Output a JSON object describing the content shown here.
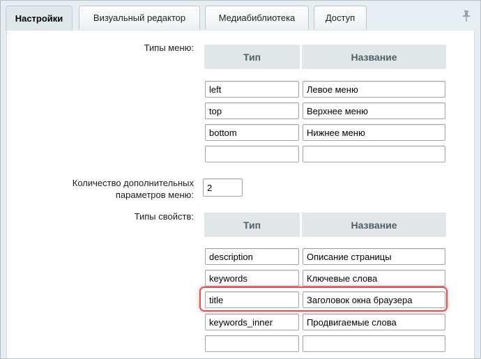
{
  "tabs": [
    {
      "label": "Настройки",
      "active": true
    },
    {
      "label": "Визуальный редактор",
      "active": false
    },
    {
      "label": "Медиабиблиотека",
      "active": false
    },
    {
      "label": "Доступ",
      "active": false
    }
  ],
  "icons": {
    "pin": "pin-icon"
  },
  "menu_types": {
    "label": "Типы меню:",
    "col_type": "Тип",
    "col_name": "Название",
    "rows": [
      {
        "type": "left",
        "name": "Левое меню"
      },
      {
        "type": "top",
        "name": "Верхнее меню"
      },
      {
        "type": "bottom",
        "name": "Нижнее меню"
      },
      {
        "type": "",
        "name": ""
      }
    ]
  },
  "extra_params": {
    "label_line1": "Количество дополнительных",
    "label_line2": "параметров меню:",
    "value": "2"
  },
  "property_types": {
    "label": "Типы свойств:",
    "col_type": "Тип",
    "col_name": "Название",
    "rows": [
      {
        "type": "description",
        "name": "Описание страницы"
      },
      {
        "type": "keywords",
        "name": "Ключевые слова"
      },
      {
        "type": "title",
        "name": "Заголовок окна браузера"
      },
      {
        "type": "keywords_inner",
        "name": "Продвигаемые слова"
      },
      {
        "type": "",
        "name": ""
      }
    ]
  },
  "colors": {
    "highlight": "#ea4f4f",
    "tab_bar": "#e7eef1",
    "header_bg": "#e1e7e9"
  }
}
